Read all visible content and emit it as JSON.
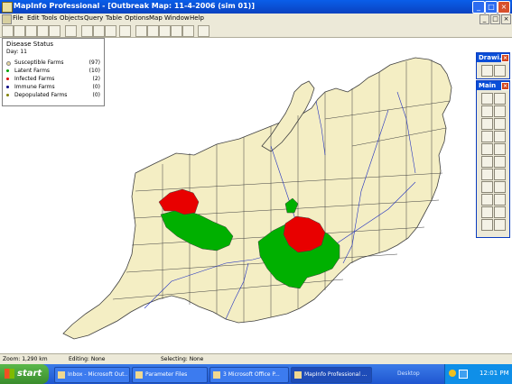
{
  "window": {
    "title": "MapInfo Professional - [Outbreak Map: 11-4-2006 (sim 01)]",
    "minimize": "_",
    "maximize": "□",
    "close": "×"
  },
  "menu": [
    "File",
    "Edit",
    "Tools",
    "Objects",
    "Query",
    "Table",
    "Options",
    "Map",
    "Window",
    "Help"
  ],
  "legend": {
    "title": "Disease Status",
    "day": "Day: 11",
    "items": [
      {
        "label": "Susceptible Farms",
        "count": "(97)",
        "color": "#e8d8a0"
      },
      {
        "label": "Latent Farms",
        "count": "(10)",
        "color": "#00a000"
      },
      {
        "label": "Infected Farms",
        "count": "(2)",
        "color": "#e00000"
      },
      {
        "label": "Immune Farms",
        "count": "(0)",
        "color": "#000080"
      },
      {
        "label": "Depopulated Farms",
        "count": "(0)",
        "color": "#808000"
      }
    ]
  },
  "panels": {
    "drawing": "Drawi...",
    "main": "Main"
  },
  "status": {
    "zoom": "Zoom: 1,290 km",
    "editing": "Editing: None",
    "selecting": "Selecting: None"
  },
  "taskbar": {
    "start": "start",
    "tasks": [
      {
        "label": "Inbox - Microsoft Out..."
      },
      {
        "label": "Parameter Files"
      },
      {
        "label": "3 Microsoft Office P..."
      },
      {
        "label": "MapInfo Professional ..."
      }
    ],
    "desktop": "Desktop",
    "time": "12:01 PM"
  },
  "colors": {
    "susceptible": "#f4eec4",
    "latent": "#00b000",
    "infected": "#e80000",
    "boundary": "#404040",
    "river": "#2030c0"
  }
}
